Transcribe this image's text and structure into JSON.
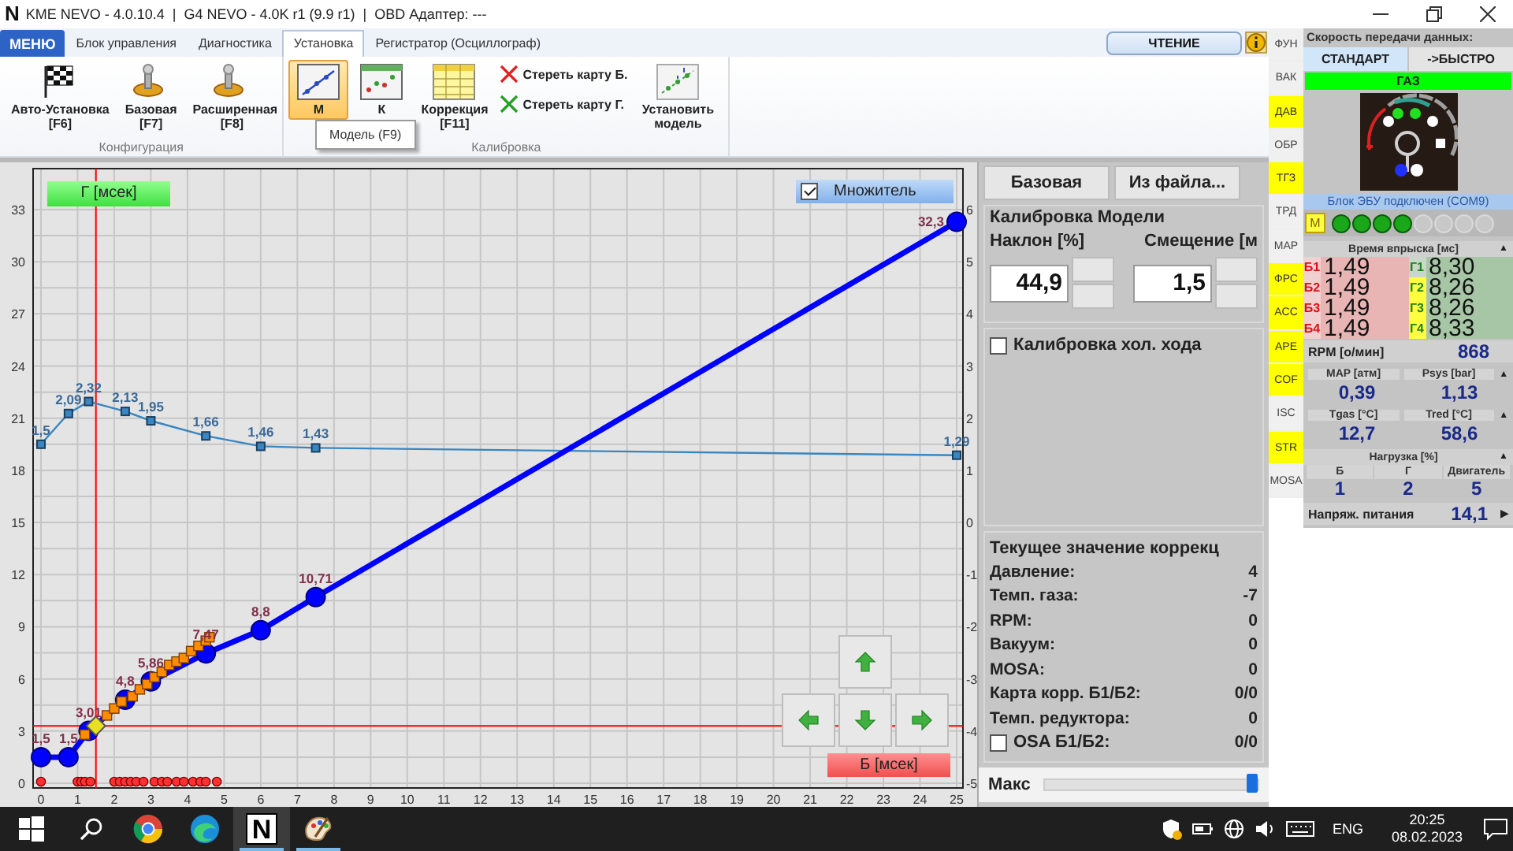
{
  "window": {
    "logo": "N",
    "title": "KME NEVO - 4.0.10.4  |  G4 NEVO - 4.0K r1 (9.9 r1)  |  OBD Адаптер: ---"
  },
  "menu_button": {
    "label": "МЕНЮ"
  },
  "tabs": [
    {
      "label": "Блок управления",
      "selected": false
    },
    {
      "label": "Диагностика",
      "selected": false
    },
    {
      "label": "Установка",
      "selected": true
    },
    {
      "label": "Регистратор (Осциллограф)",
      "selected": false
    }
  ],
  "read_button": {
    "label": "ЧТЕНИЕ"
  },
  "ribbon": {
    "groups": [
      {
        "label": "Конфигурация",
        "buttons": [
          {
            "kind": "large",
            "label": "Авто-Установка",
            "key": "[F6]",
            "selected": false
          },
          {
            "kind": "large",
            "label": "Базовая",
            "key": "[F7]",
            "selected": false
          },
          {
            "kind": "large",
            "label": "Расширенная",
            "key": "[F8]",
            "selected": false
          }
        ]
      },
      {
        "label": "Калибровка",
        "buttons": [
          {
            "kind": "large",
            "label": "М",
            "selected": true
          },
          {
            "kind": "large",
            "label": "К",
            "selected": false
          },
          {
            "kind": "large",
            "label": "Коррекция",
            "key": "[F11]",
            "selected": false
          },
          {
            "kind": "small",
            "label": "Стереть карту Б.",
            "selected": false
          },
          {
            "kind": "small",
            "label": "Стереть карту Г.",
            "selected": false
          },
          {
            "kind": "large",
            "label": "Установить модель",
            "selected": false
          }
        ]
      }
    ],
    "tooltip": "Модель (F9)"
  },
  "chart_panel": {
    "multiplier": {
      "label": "Множитель",
      "checked": true
    },
    "chart_data": {
      "type": "line",
      "xlabel": "Б [мсек]",
      "ylabel": "Г [мсек]",
      "xlim": [
        0,
        25
      ],
      "ylim": [
        0,
        33
      ],
      "xticks": [
        0,
        1,
        2,
        3,
        4,
        5,
        6,
        7,
        8,
        9,
        10,
        11,
        12,
        13,
        14,
        15,
        16,
        17,
        18,
        19,
        20,
        21,
        22,
        23,
        24,
        25
      ],
      "yticks": [
        0,
        3,
        6,
        9,
        12,
        15,
        18,
        21,
        24,
        27,
        30,
        33
      ],
      "y2ticks": [
        -5,
        -4,
        -3,
        -2,
        -1,
        0,
        1,
        2,
        3,
        4,
        5,
        6
      ],
      "y2lim": [
        -5,
        6
      ],
      "series": [
        {
          "type": "line",
          "axis": "y2",
          "color": "#3a86c0",
          "x": [
            0,
            0.75,
            1.3,
            2.3,
            3,
            4.5,
            6,
            7.5,
            25
          ],
          "marker": "square",
          "values": [
            1.5,
            2.09,
            2.32,
            2.13,
            1.95,
            1.66,
            1.46,
            1.43,
            1.29
          ],
          "value_labels": [
            "1,5",
            "2,09",
            "2,32",
            "2,13",
            "1,95",
            "1,66",
            "1,46",
            "1,43",
            "1,29"
          ]
        },
        {
          "type": "line",
          "color": "#0000ff",
          "x": [
            0,
            0.75,
            1.3,
            2.3,
            3,
            4.5,
            6,
            7.5,
            25
          ],
          "marker": "circle",
          "values": [
            1.5,
            1.5,
            3.01,
            4.8,
            5.86,
            7.47,
            8.8,
            10.71,
            32.3
          ],
          "value_labels": [
            "1,5",
            "1,5",
            "3,01",
            "4,8",
            "5,86",
            "7,47",
            "8,8",
            "10,71",
            "32,3"
          ]
        },
        {
          "type": "scatter",
          "marker": "square",
          "color": "#ff8c00",
          "x": [
            1.2,
            1.4,
            1.6,
            1.8,
            2.0,
            2.2,
            2.5,
            2.7,
            2.9,
            3.1,
            3.3,
            3.5,
            3.7,
            3.9,
            4.1,
            4.3,
            4.5,
            4.6
          ],
          "values": [
            2.8,
            null,
            null,
            3.9,
            4.3,
            4.7,
            5.0,
            5.4,
            5.7,
            6.1,
            6.4,
            6.8,
            7.0,
            7.2,
            7.6,
            7.9,
            8.2,
            8.4
          ]
        },
        {
          "type": "scatter",
          "marker": "circle",
          "color": "#ff3030",
          "x": [
            0,
            1,
            1.1,
            1.2,
            1.35,
            2,
            2.15,
            2.3,
            2.45,
            2.6,
            2.8,
            3.1,
            3.3,
            3.45,
            3.7,
            3.9,
            4.15,
            4.35,
            4.5,
            4.8
          ],
          "values": [
            0,
            0,
            0,
            0,
            0,
            0,
            0,
            0,
            0,
            0,
            0,
            0,
            0,
            0,
            0,
            0,
            0,
            0,
            0,
            0
          ]
        },
        {
          "type": "scatter",
          "marker": "diamond",
          "color": "#e8e020",
          "x": [
            1.5
          ],
          "values": [
            3.3
          ]
        }
      ],
      "grid": true,
      "ref_lines": [
        {
          "axis": "x",
          "value": 1.5
        },
        {
          "axis": "y",
          "value": 3.3
        }
      ]
    }
  },
  "model_panel": {
    "buttons": [
      "Базовая",
      "Из файла..."
    ],
    "title": "Калибровка Модели",
    "fields": [
      {
        "label": "Наклон [%]",
        "value": "44,9"
      },
      {
        "label": "Смещение [м",
        "value": "1,5"
      }
    ],
    "idle": {
      "label": "Калибровка хол. хода",
      "checked": false
    },
    "correction": {
      "title": "Текущее значение коррекц",
      "rows": [
        {
          "kind": "text",
          "label": "Давление:",
          "value": "4"
        },
        {
          "kind": "text",
          "label": "Темп. газа:",
          "value": "-7"
        },
        {
          "kind": "text",
          "label": "RPM:",
          "value": "0"
        },
        {
          "kind": "text",
          "label": "Вакуум:",
          "value": "0"
        },
        {
          "kind": "text",
          "label": "MOSA:",
          "value": "0"
        },
        {
          "kind": "text",
          "label": "Карта корр. Б1/Б2:",
          "value": "0/0"
        },
        {
          "kind": "text",
          "label": "Темп. редуктора:",
          "value": "0"
        },
        {
          "kind": "checkbox",
          "label": "OSA Б1/Б2:",
          "value": "0/0",
          "checked": false
        }
      ]
    },
    "max_slider": {
      "label": "Макс",
      "level": 1
    }
  },
  "side_tabs": [
    {
      "label": "ФУН",
      "on": false
    },
    {
      "label": "ВАК",
      "on": false
    },
    {
      "label": "ДАВ",
      "on": true
    },
    {
      "label": "ОБР",
      "on": false
    },
    {
      "label": "ТГЗ",
      "on": true
    },
    {
      "label": "ТРД",
      "on": false
    },
    {
      "label": "MAP",
      "on": false
    },
    {
      "label": "ФРС",
      "on": true
    },
    {
      "label": "ACC",
      "on": true
    },
    {
      "label": "APE",
      "on": true
    },
    {
      "label": "COF",
      "on": true
    },
    {
      "label": "ISC",
      "on": false
    },
    {
      "label": "STR",
      "on": true
    },
    {
      "label": "MOSA",
      "on": false
    }
  ],
  "status_panel": {
    "speed_title": "Скорость передачи данных:",
    "speed_modes": [
      {
        "label": "СТАНДАРТ",
        "selected": true
      },
      {
        "label": "->БЫСТРО",
        "selected": false
      }
    ],
    "fuel": "ГАЗ",
    "ecu_status": "Блок ЭБУ подключен (COM9)",
    "mode_badge": "M",
    "leds": [
      {
        "on": true
      },
      {
        "on": true
      },
      {
        "on": true
      },
      {
        "on": true
      },
      {
        "on": false
      },
      {
        "on": false
      },
      {
        "on": false
      },
      {
        "on": false
      }
    ],
    "injection": {
      "title": "Время впрыска [мс]",
      "toggle": "▲",
      "rows": [
        {
          "petrol_label": "Б1",
          "petrol": "1,49",
          "gas_label": "Г1",
          "gas": "8,30",
          "highlighted": false
        },
        {
          "petrol_label": "Б2",
          "petrol": "1,49",
          "gas_label": "Г2",
          "gas": "8,26",
          "highlighted": true
        },
        {
          "petrol_label": "Б3",
          "petrol": "1,49",
          "gas_label": "Г3",
          "gas": "8,26",
          "highlighted": true
        },
        {
          "petrol_label": "Б4",
          "petrol": "1,49",
          "gas_label": "Г4",
          "gas": "8,33",
          "highlighted": true
        }
      ]
    },
    "rpm": {
      "label": "RPM [о/мин]",
      "value": "868"
    },
    "readings": [
      {
        "toggle": "▲",
        "cells": [
          {
            "label": "MAP [атм]",
            "value": "0,39"
          },
          {
            "label": "Psys [bar]",
            "value": "1,13"
          }
        ]
      },
      {
        "toggle": "▲",
        "cells": [
          {
            "label": "Tgas [°C]",
            "value": "12,7"
          },
          {
            "label": "Tred [°C]",
            "value": "58,6"
          }
        ]
      }
    ],
    "load": {
      "title": "Нагрузка [%]",
      "toggle": "▲",
      "cells": [
        {
          "label": "Б",
          "value": "1"
        },
        {
          "label": "Г",
          "value": "2"
        },
        {
          "label": "Двигатель",
          "value": "5"
        }
      ]
    },
    "voltage": {
      "label": "Напряж. питания",
      "value": "14,1",
      "toggle": "▶"
    }
  },
  "taskbar": {
    "apps": [
      {
        "selected": false,
        "running": false
      },
      {
        "selected": false,
        "running": false
      },
      {
        "glyph": "N",
        "selected": true,
        "running": true
      },
      {
        "selected": false,
        "running": true
      }
    ],
    "language": "ENG",
    "time": "20:25",
    "date": "08.02.2023"
  }
}
